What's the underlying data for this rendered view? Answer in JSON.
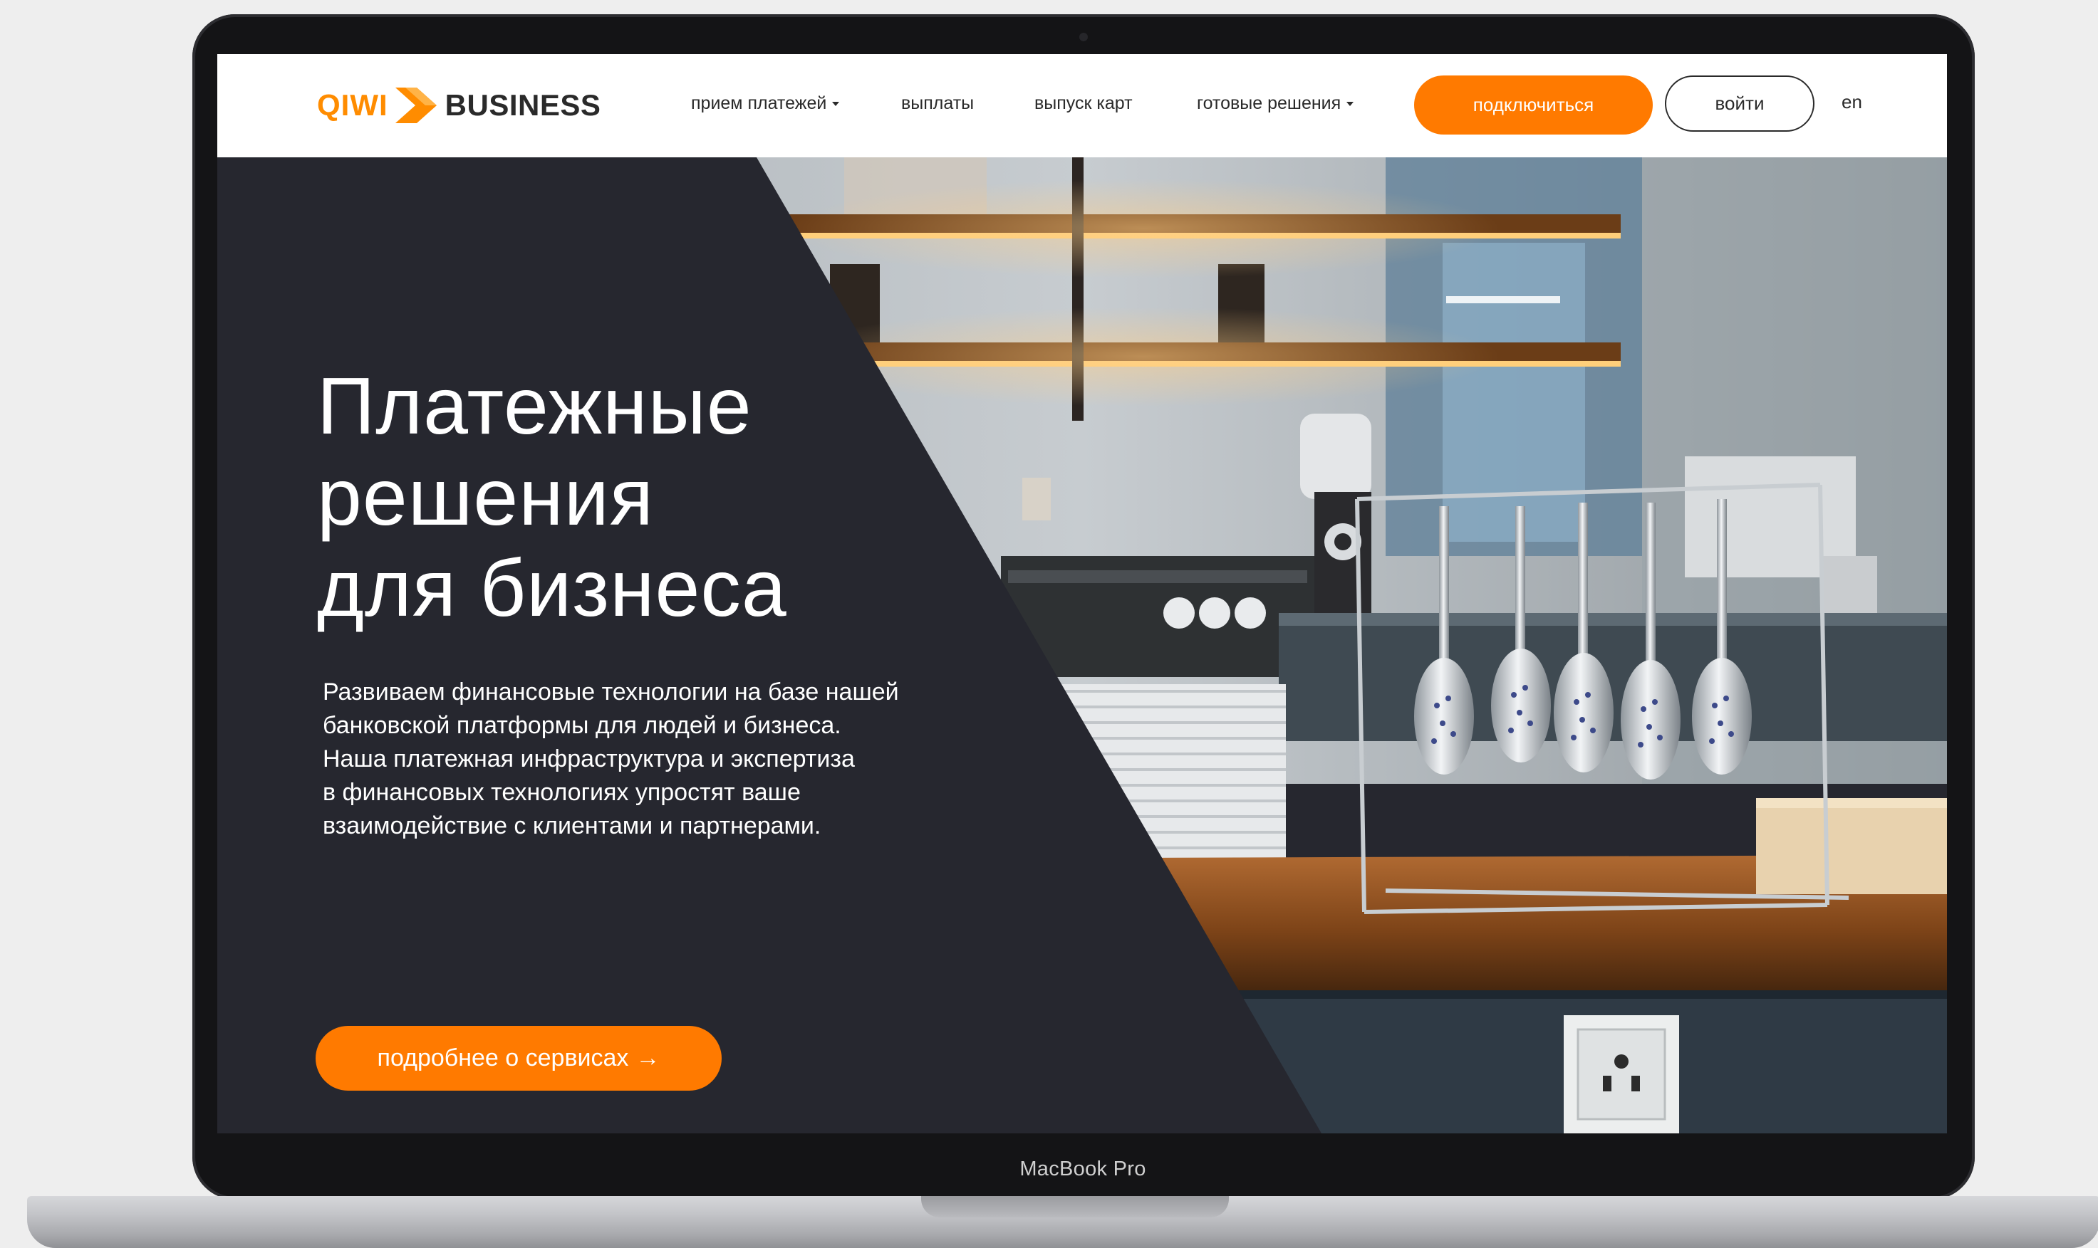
{
  "device": {
    "label": "MacBook Pro"
  },
  "header": {
    "logo": {
      "brand": "QIWI",
      "product": "BUSINESS"
    },
    "nav": [
      {
        "label": "прием платежей",
        "has_dropdown": true
      },
      {
        "label": "выплаты",
        "has_dropdown": false
      },
      {
        "label": "выпуск карт",
        "has_dropdown": false
      },
      {
        "label": "готовые решения",
        "has_dropdown": true
      }
    ],
    "connect_label": "подключиться",
    "login_label": "войти",
    "lang": "en"
  },
  "hero": {
    "title_lines": [
      "Платежные",
      "решения",
      "для бизнеса"
    ],
    "description_lines": [
      "Развиваем финансовые технологии на базе нашей",
      "банковской платформы для людей и бизнеса.",
      "Наша платежная инфраструктура и экспертиза",
      "в финансовых технологиях упростят ваше",
      "взаимодействие с клиентами и партнерами."
    ],
    "cta_label": "подробнее о сервисах",
    "cta_arrow": "→"
  },
  "colors": {
    "accent": "#ff7a00",
    "dark_panel": "#26272f",
    "frame": "#141416"
  },
  "icons": {
    "logo_mark": "qiwi-chevron-icon",
    "dropdown": "caret-down-icon",
    "cta": "arrow-right-icon",
    "socket": "power-outlet"
  }
}
